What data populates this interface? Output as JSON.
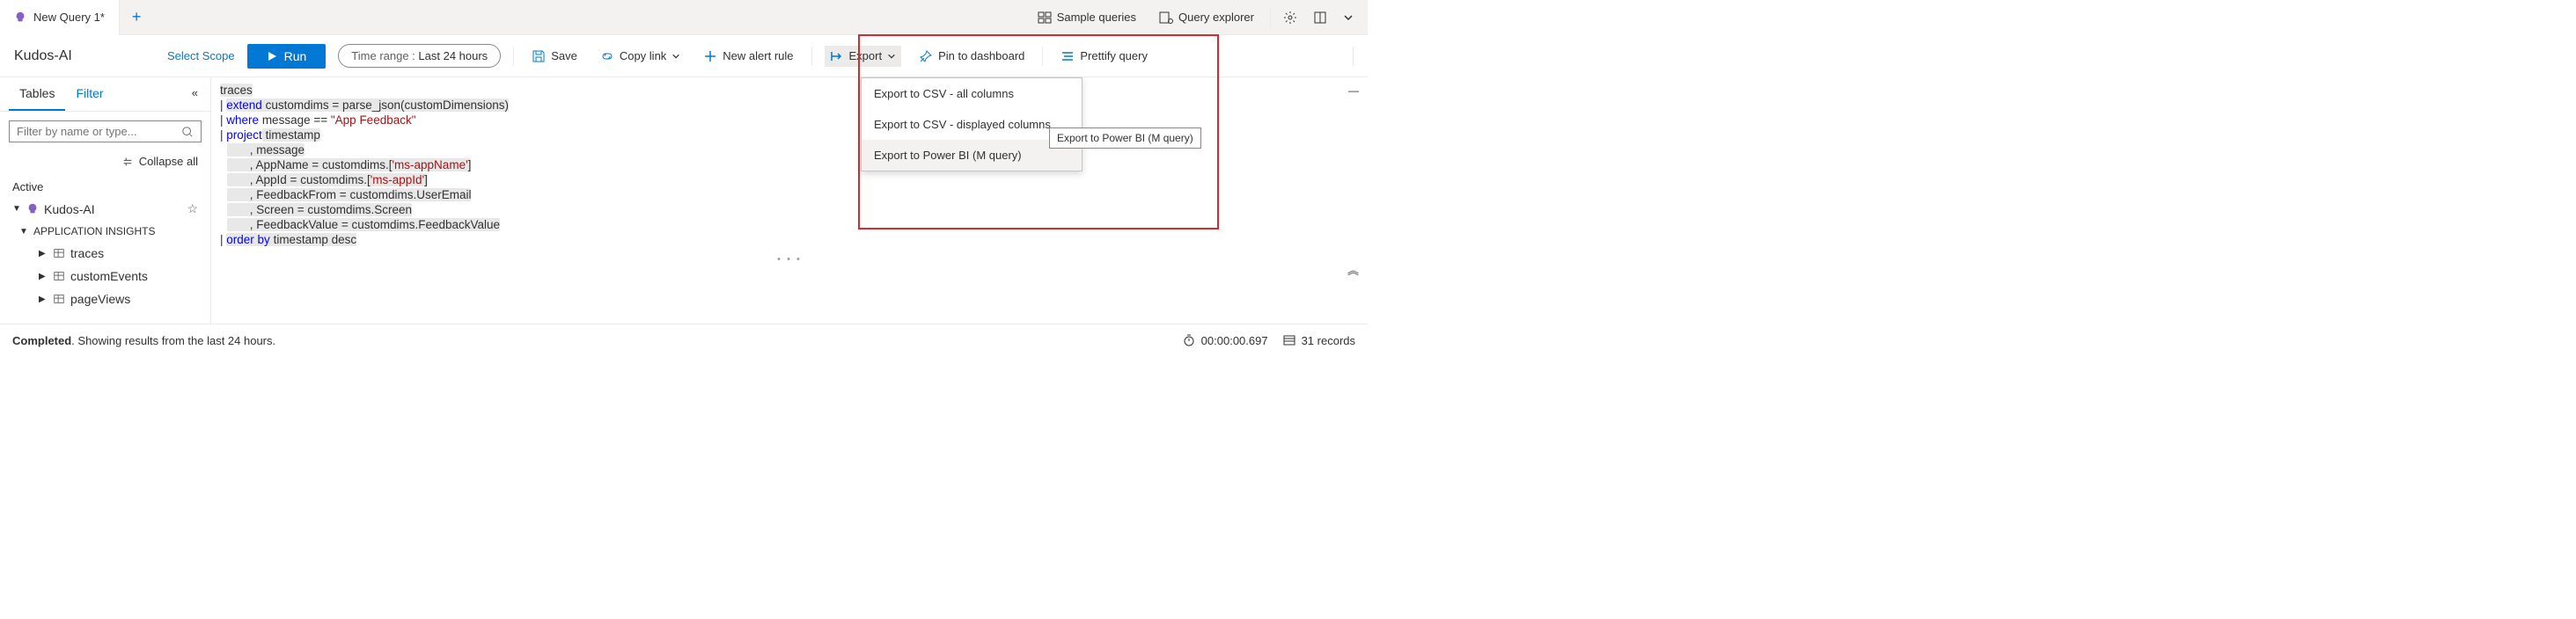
{
  "tab": {
    "title": "New Query 1*"
  },
  "header_right": {
    "sample_queries": "Sample queries",
    "query_explorer": "Query explorer"
  },
  "toolbar": {
    "scope_name": "Kudos-AI",
    "select_scope": "Select Scope",
    "run": "Run",
    "time_range_label": "Time range : ",
    "time_range_value": "Last 24 hours",
    "save": "Save",
    "copy_link": "Copy link",
    "new_alert": "New alert rule",
    "export": "Export",
    "pin": "Pin to dashboard",
    "prettify": "Prettify query"
  },
  "export_menu": {
    "csv_all": "Export to CSV - all columns",
    "csv_disp": "Export to CSV - displayed columns",
    "powerbi": "Export to Power BI (M query)"
  },
  "tooltip": "Export to Power BI (M query)",
  "sidebar": {
    "tab_tables": "Tables",
    "tab_filter": "Filter",
    "search_placeholder": "Filter by name or type...",
    "collapse_all": "Collapse all",
    "section_active": "Active",
    "tree": {
      "root": "Kudos-AI",
      "group": "APPLICATION INSIGHTS",
      "items": [
        "traces",
        "customEvents",
        "pageViews"
      ]
    }
  },
  "editor": {
    "lines": [
      {
        "t": "plain",
        "text": "traces"
      },
      {
        "t": "extend",
        "pipe": "|",
        "kw": "extend",
        "rest": " customdims = parse_json(customDimensions)"
      },
      {
        "t": "where",
        "pipe": "|",
        "kw": "where",
        "mid": " message == ",
        "str": "\"App Feedback\""
      },
      {
        "t": "project",
        "pipe": "|",
        "kw": "project",
        "rest": " timestamp"
      },
      {
        "t": "cont",
        "text": "       , message"
      },
      {
        "t": "contprop",
        "pre": "       , AppName = customdims.[",
        "prop": "'ms-appName'",
        "post": "]"
      },
      {
        "t": "contprop",
        "pre": "       , AppId = customdims.[",
        "prop": "'ms-appId'",
        "post": "]"
      },
      {
        "t": "cont",
        "text": "       , FeedbackFrom = customdims.UserEmail"
      },
      {
        "t": "cont",
        "text": "       , Screen = customdims.Screen"
      },
      {
        "t": "cont",
        "text": "       , FeedbackValue = customdims.FeedbackValue"
      },
      {
        "t": "order",
        "pipe": "|",
        "kw": "order by",
        "rest": " timestamp desc"
      }
    ]
  },
  "status": {
    "completed": "Completed",
    "text": ". Showing results from the last 24 hours.",
    "duration": "00:00:00.697",
    "records": "31 records"
  }
}
